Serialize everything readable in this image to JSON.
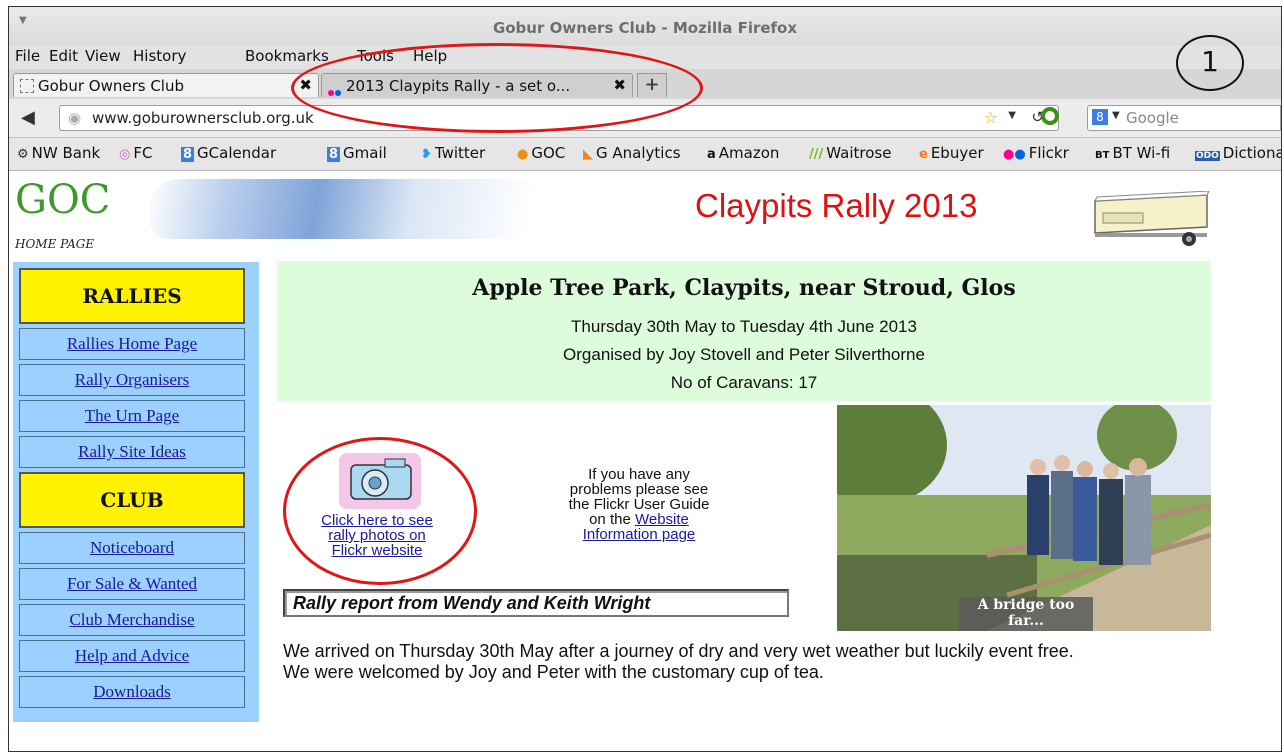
{
  "window": {
    "title": "Gobur Owners Club - Mozilla Firefox"
  },
  "menu": [
    "File",
    "Edit",
    "View",
    "History",
    "Bookmarks",
    "Tools",
    "Help"
  ],
  "tabs": [
    {
      "label": "Gobur Owners Club",
      "active": true
    },
    {
      "label": "2013 Claypits Rally - a set o...",
      "active": false
    }
  ],
  "newtab_label": "+",
  "nav": {
    "url": "www.goburownersclub.org.uk",
    "search_placeholder": "Google"
  },
  "bookmarks": [
    {
      "label": "NW Bank",
      "icon": "nwbank-icon"
    },
    {
      "label": "FC",
      "icon": "fc-icon"
    },
    {
      "label": "GCalendar",
      "icon": "google-icon"
    },
    {
      "label": "Gmail",
      "icon": "google-icon"
    },
    {
      "label": "Twitter",
      "icon": "twitter-icon"
    },
    {
      "label": "GOC",
      "icon": "goc-icon"
    },
    {
      "label": "G Analytics",
      "icon": "analytics-icon"
    },
    {
      "label": "Amazon",
      "icon": "amazon-icon"
    },
    {
      "label": "Waitrose",
      "icon": "waitrose-icon"
    },
    {
      "label": "Ebuyer",
      "icon": "ebuyer-icon"
    },
    {
      "label": "Flickr",
      "icon": "flickr-icon"
    },
    {
      "label": "BT Wi-fi",
      "icon": "bt-icon"
    },
    {
      "label": "Dictiona",
      "icon": "dictionary-icon"
    }
  ],
  "annotation": {
    "number": "1"
  },
  "site": {
    "logo_text": "GOC",
    "logo_sub": "HOME PAGE",
    "banner_title": "Claypits Rally 2013"
  },
  "sidebar": {
    "rallies_heading": "RALLIES",
    "rallies_links": [
      "Rallies Home Page",
      "Rally Organisers",
      "The Urn Page",
      "Rally Site Ideas"
    ],
    "club_heading": "CLUB",
    "club_links": [
      "Noticeboard",
      "For Sale & Wanted",
      "Club Merchandise",
      "Help and Advice",
      "Downloads"
    ]
  },
  "info": {
    "heading": "Apple Tree Park, Claypits, near Stroud, Glos",
    "dates": "Thursday 30th May to Tuesday 4th June 2013",
    "organisers": "Organised by Joy Stovell and Peter Silverthorne",
    "caravans": "No of Caravans: 17"
  },
  "flickr_link": {
    "line1": "Click here to see",
    "line2": "rally photos on",
    "line3": "Flickr website"
  },
  "help_note": {
    "line1": "If you have any",
    "line2": "problems please see",
    "line3": "the Flickr User Guide",
    "line4_prefix": "on the ",
    "line4_link": "Website",
    "line5_link": "Information page"
  },
  "report_title": "Rally report from Wendy and Keith Wright",
  "photo_caption": {
    "line1": "A bridge too",
    "line2": "far..."
  },
  "body": {
    "p1": "We arrived on Thursday 30th May after a journey of dry and very wet weather but luckily event free.",
    "p2": "We were welcomed by Joy and Peter with the customary cup of tea."
  },
  "colors": {
    "highlight_circle": "#e01616",
    "sidebar_bg": "#9bd0ff",
    "sidebar_heading": "#fff200",
    "info_bg": "#dcfcdc",
    "banner_title": "#e01010"
  }
}
